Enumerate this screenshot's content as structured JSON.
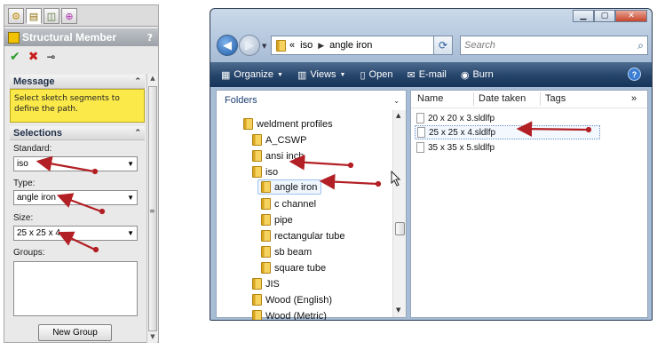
{
  "property_manager": {
    "title": "Structural Member",
    "help": "?",
    "tabs": [
      "feature-manager-tab",
      "property-manager-tab",
      "configuration-manager-tab",
      "dimxpert-manager-tab"
    ],
    "actions": {
      "ok": "✔",
      "cancel": "✖",
      "pin": "⊸"
    },
    "message_group": {
      "title": "Message",
      "text": "Select sketch segments to define the path."
    },
    "selections_group": {
      "title": "Selections",
      "standard_label": "Standard:",
      "standard_value": "iso",
      "type_label": "Type:",
      "type_value": "angle iron",
      "size_label": "Size:",
      "size_value": "25 x 25 x 4",
      "groups_label": "Groups:",
      "new_group_button": "New Group"
    }
  },
  "explorer": {
    "address": {
      "prefix": "«",
      "crumbs": [
        "iso",
        "angle iron"
      ]
    },
    "search_placeholder": "Search",
    "toolbar": {
      "organize": "Organize",
      "views": "Views",
      "open": "Open",
      "email": "E-mail",
      "burn": "Burn",
      "help": "?"
    },
    "folders_header": "Folders",
    "tree": [
      "weldment profiles",
      "A_CSWP",
      "ansi inch",
      "iso",
      "angle iron",
      "c channel",
      "pipe",
      "rectangular tube",
      "sb beam",
      "square tube",
      "JIS",
      "Wood (English)",
      "Wood (Metric)"
    ],
    "selected_folder": "angle iron",
    "columns": [
      "Name",
      "Date taken",
      "Tags",
      "»"
    ],
    "files": [
      "20 x 20 x 3.sldlfp",
      "25 x 25 x 4.sldlfp",
      "35 x 35 x 5.sldlfp"
    ],
    "selected_file": "25 x 25 x 4.sldlfp"
  },
  "colors": {
    "annotation_arrow": "#b21f24",
    "message_background": "#fbe94a",
    "explorer_command_bar": "#25446a"
  }
}
